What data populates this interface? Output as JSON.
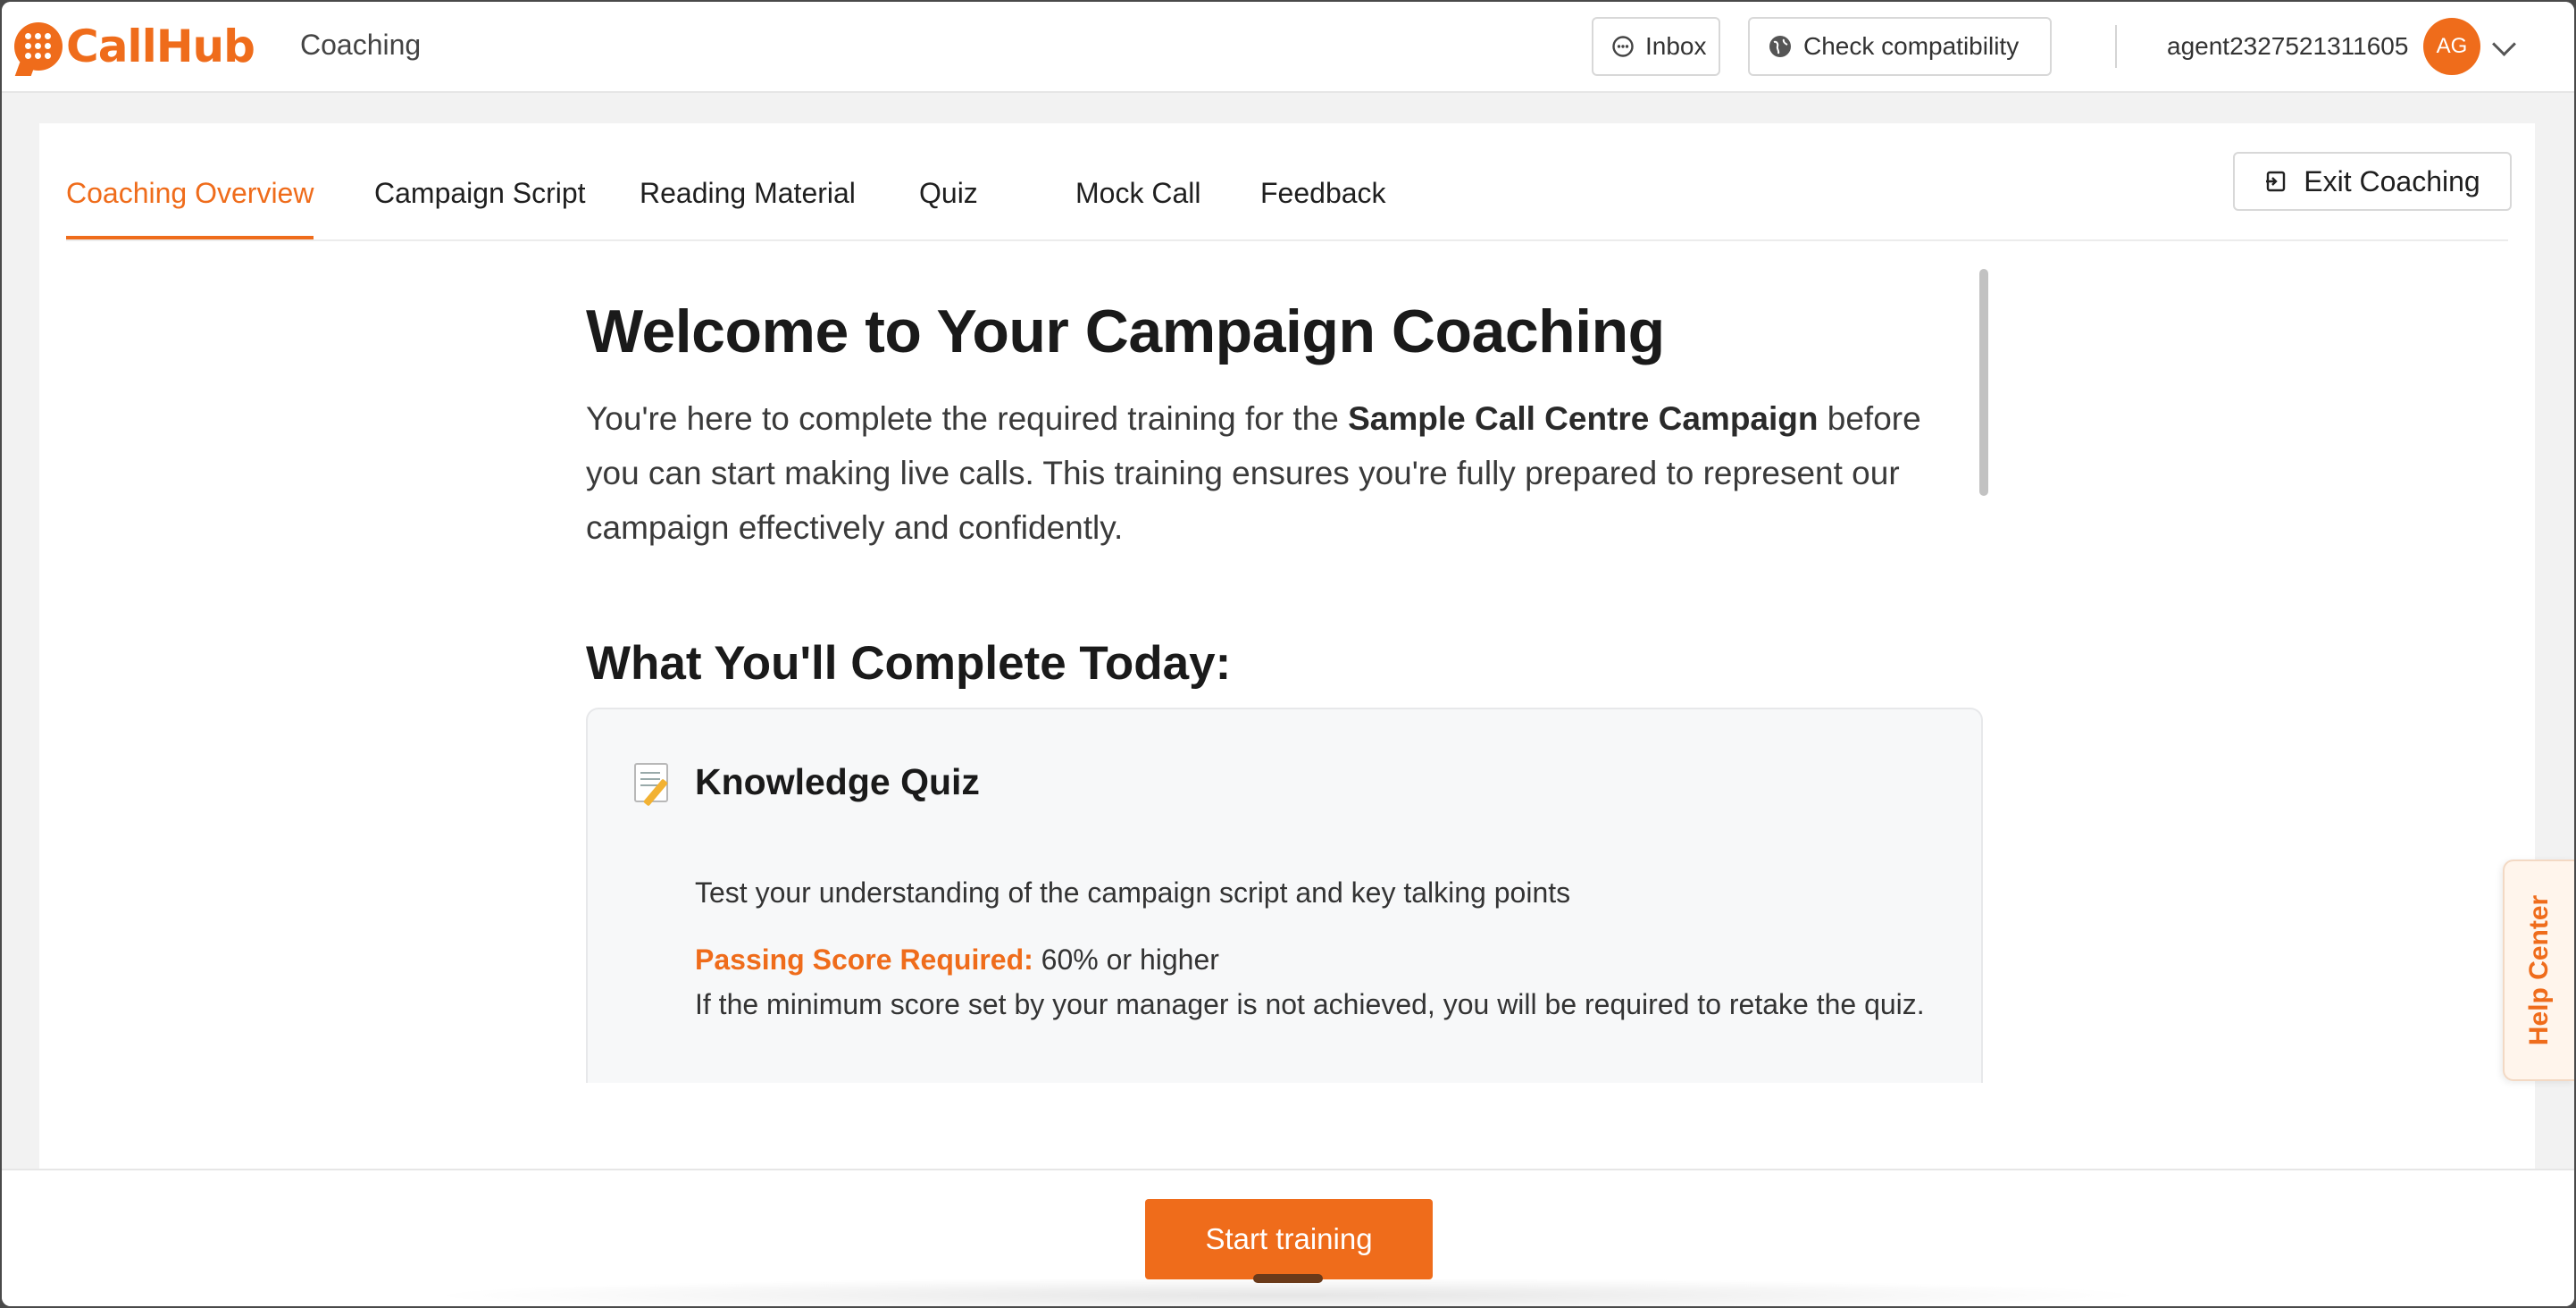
{
  "header": {
    "logo_text": "CallHub",
    "section": "Coaching",
    "inbox_label": "Inbox",
    "compat_label": "Check compatibility",
    "agent_name": "agent2327521311605",
    "avatar_initials": "AG"
  },
  "tabs": [
    {
      "label": "Coaching Overview",
      "active": true
    },
    {
      "label": "Campaign Script",
      "active": false
    },
    {
      "label": "Reading Material",
      "active": false
    },
    {
      "label": "Quiz",
      "active": false
    },
    {
      "label": "Mock Call",
      "active": false
    },
    {
      "label": "Feedback",
      "active": false
    }
  ],
  "exit_label": "Exit Coaching",
  "main": {
    "title": "Welcome to Your Campaign Coaching",
    "intro_prefix": "You're here to complete the required training for the ",
    "campaign_name": "Sample Call Centre Campaign",
    "intro_suffix": " before you can start making live calls. This training ensures you're fully prepared to represent our campaign effectively and confidently.",
    "complete_heading": "What You'll Complete Today:",
    "quiz": {
      "icon": "memo-icon",
      "title": "Knowledge Quiz",
      "description": "Test your understanding of the campaign script and key talking points",
      "pass_label": "Passing Score Required:",
      "pass_value": " 60% or higher",
      "retake_note": "If the minimum score set by your manager is not achieved, you will be required to retake the quiz."
    }
  },
  "footer": {
    "start_label": "Start training"
  },
  "help_center_label": "Help Center",
  "colors": {
    "accent": "#ef6c1b"
  }
}
